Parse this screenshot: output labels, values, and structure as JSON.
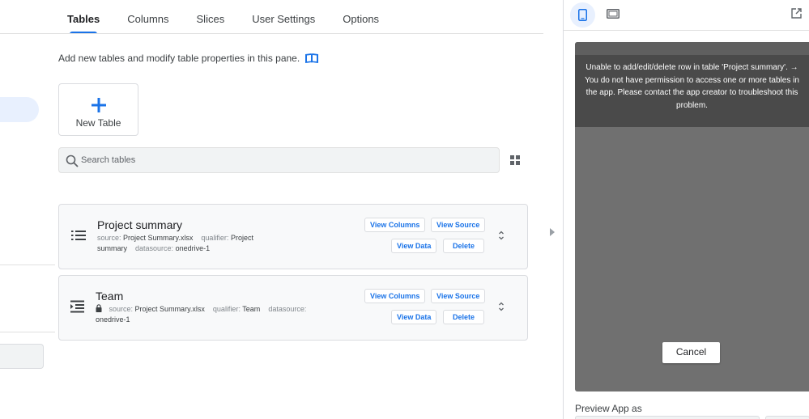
{
  "tabs": [
    {
      "label": "Tables",
      "active": true
    },
    {
      "label": "Columns",
      "active": false
    },
    {
      "label": "Slices",
      "active": false
    },
    {
      "label": "User Settings",
      "active": false
    },
    {
      "label": "Options",
      "active": false
    }
  ],
  "intro": {
    "text": "Add new tables and modify table properties in this pane."
  },
  "new_table": {
    "label": "New Table"
  },
  "search": {
    "placeholder": "Search tables"
  },
  "tables": [
    {
      "name": "Project summary",
      "source_key": "source:",
      "source": "Project Summary.xlsx",
      "qualifier_key": "qualifier:",
      "qualifier": "Project summary",
      "qualifier_line1": "Project",
      "qualifier_line2": "summary",
      "datasource_key": "datasource:",
      "datasource": "onedrive-1",
      "locked": false,
      "buttons": {
        "view_columns": "View Columns",
        "view_source": "View Source",
        "view_data": "View Data",
        "delete": "Delete"
      }
    },
    {
      "name": "Team",
      "source_key": "source:",
      "source": "Project Summary.xlsx",
      "qualifier_key": "qualifier:",
      "qualifier": "Team",
      "datasource_key": "datasource:",
      "datasource": "onedrive-1",
      "locked": true,
      "buttons": {
        "view_columns": "View Columns",
        "view_source": "View Source",
        "view_data": "View Data",
        "delete": "Delete"
      }
    }
  ],
  "preview": {
    "error_message": "Unable to add/edit/delete row in table 'Project summary'. → You do not have permission to access one or more tables in the app. Please contact the app creator to troubleshoot this problem.",
    "cancel_label": "Cancel",
    "preview_as_label": "Preview App as"
  },
  "icons": {
    "book": "book-icon",
    "plus": "plus-icon",
    "search": "search-icon",
    "grid": "grid-view-icon",
    "list": "list-icon",
    "list_indent": "list-indent-icon",
    "lock": "lock-icon",
    "expand": "unfold-icon",
    "phone": "phone-icon",
    "tablet": "tablet-icon",
    "open": "open-in-new-icon",
    "collapse": "chevron-right-icon"
  },
  "colors": {
    "accent": "#1a73e8",
    "device_bg": "#707070",
    "error_bg": "#4a4a4a"
  }
}
